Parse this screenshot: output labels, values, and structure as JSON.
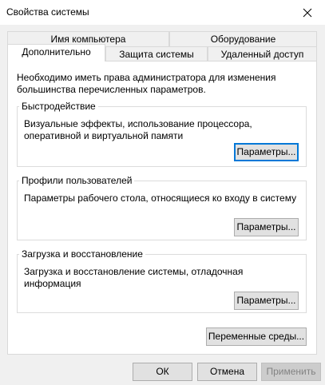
{
  "window": {
    "title": "Свойства системы",
    "close_icon": "close-icon"
  },
  "tabs": {
    "row1": [
      "Имя компьютера",
      "Оборудование"
    ],
    "row2": [
      "Дополнительно",
      "Защита системы",
      "Удаленный доступ"
    ],
    "selected": "Дополнительно"
  },
  "panel": {
    "intro": "Необходимо иметь права администратора для изменения большинства перечисленных параметров.",
    "performance": {
      "title": "Быстродействие",
      "description": "Визуальные эффекты, использование процессора, оперативной и виртуальной памяти",
      "button": "Параметры..."
    },
    "user_profiles": {
      "title": "Профили пользователей",
      "description": "Параметры рабочего стола, относящиеся ко входу в систему",
      "button": "Параметры..."
    },
    "startup_recovery": {
      "title": "Загрузка и восстановление",
      "description": "Загрузка и восстановление системы, отладочная информация",
      "button": "Параметры..."
    },
    "env_vars_button": "Переменные среды..."
  },
  "footer": {
    "ok": "ОК",
    "cancel": "Отмена",
    "apply": "Применить"
  },
  "colors": {
    "accent": "#0078d7",
    "dialog_bg": "#f0f0f0",
    "panel_bg": "#ffffff"
  }
}
